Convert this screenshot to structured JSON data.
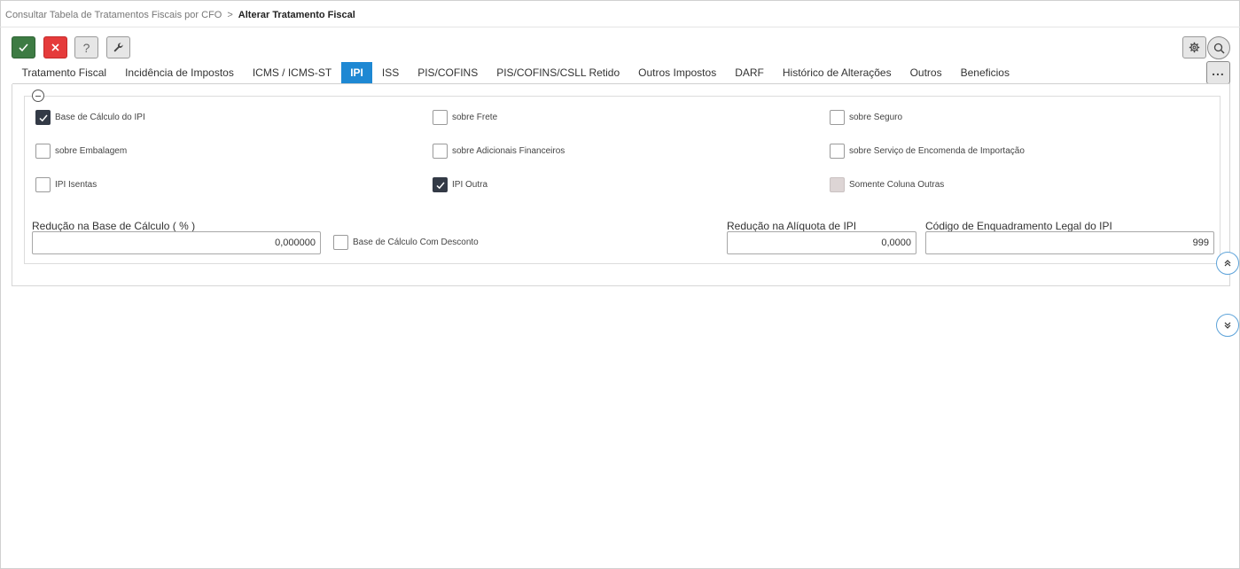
{
  "breadcrumb": {
    "parent": "Consultar Tabela de Tratamentos Fiscais por CFO",
    "separator": ">",
    "current": "Alterar Tratamento Fiscal"
  },
  "toolbar": {
    "confirm_icon": "check-icon",
    "cancel_icon": "close-icon",
    "help_label": "?",
    "tool_icon": "wrench-icon",
    "settings_icon": "gear-icon",
    "search_icon": "search-icon",
    "more_label": "...",
    "colors": {
      "confirm": "#3d7b43",
      "cancel": "#e53b3b"
    }
  },
  "tabs": [
    {
      "label": "Tratamento Fiscal",
      "active": false
    },
    {
      "label": "Incidência de Impostos",
      "active": false
    },
    {
      "label": "ICMS / ICMS-ST",
      "active": false
    },
    {
      "label": "IPI",
      "active": true
    },
    {
      "label": "ISS",
      "active": false
    },
    {
      "label": "PIS/COFINS",
      "active": false
    },
    {
      "label": "PIS/COFINS/CSLL Retido",
      "active": false
    },
    {
      "label": "Outros Impostos",
      "active": false
    },
    {
      "label": "DARF",
      "active": false
    },
    {
      "label": "Histórico de Alterações",
      "active": false
    },
    {
      "label": "Outros",
      "active": false
    },
    {
      "label": "Beneficios",
      "active": false
    }
  ],
  "accent_color": "#1e88d3",
  "checkboxes": {
    "base_calculo_ipi": {
      "label": "Base de Cálculo do IPI",
      "checked": true
    },
    "sobre_frete": {
      "label": "sobre Frete",
      "checked": false
    },
    "sobre_seguro": {
      "label": "sobre Seguro",
      "checked": false
    },
    "sobre_embalagem": {
      "label": "sobre Embalagem",
      "checked": false
    },
    "sobre_adicionais_financeiros": {
      "label": "sobre Adicionais Financeiros",
      "checked": false
    },
    "sobre_servico_encomenda": {
      "label": "sobre Serviço de Encomenda de Importação",
      "checked": false
    },
    "ipi_isentas": {
      "label": "IPI Isentas",
      "checked": false
    },
    "ipi_outra": {
      "label": "IPI Outra",
      "checked": true
    },
    "somente_coluna_outras": {
      "label": "Somente Coluna Outras",
      "checked": false,
      "disabled": true
    },
    "base_calculo_com_desconto": {
      "label": "Base de Cálculo Com Desconto",
      "checked": false
    }
  },
  "fields": {
    "reducao_base": {
      "label": "Redução na Base de Cálculo ( % )",
      "value": "0,000000"
    },
    "reducao_aliquota": {
      "label": "Redução na Alíquota de IPI",
      "value": "0,0000"
    },
    "codigo_enquadramento": {
      "label": "Código de Enquadramento Legal do IPI",
      "value": "999"
    }
  },
  "nav": {
    "scroll_up_icon": "double-chevron-up-icon",
    "scroll_down_icon": "double-chevron-down-icon"
  }
}
